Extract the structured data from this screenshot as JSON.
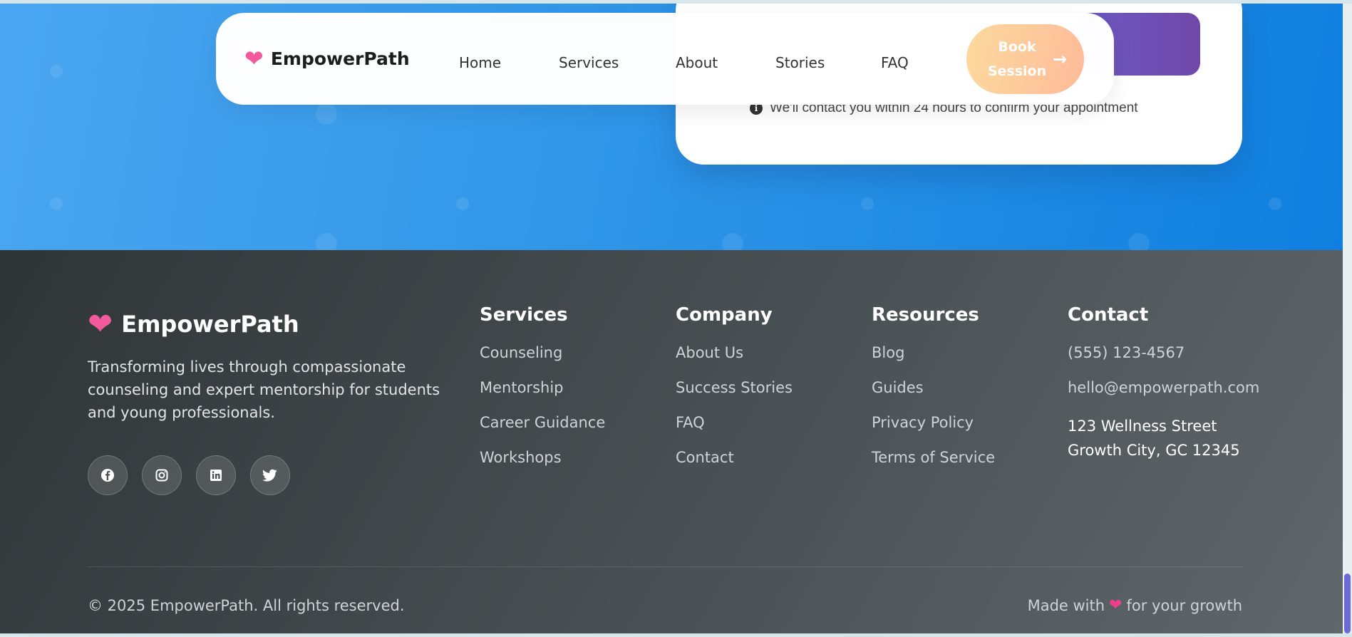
{
  "nav": {
    "brand": "EmpowerPath",
    "links": [
      "Home",
      "Services",
      "About",
      "Stories",
      "FAQ"
    ],
    "cta_label": "Book Session",
    "cta_icon": "arrow-right-icon"
  },
  "booking": {
    "note": "We'll contact you within 24 hours to confirm your appointment",
    "note_icon": "info-icon"
  },
  "footer": {
    "brand": "EmpowerPath",
    "tagline": "Transforming lives through compassionate counseling and expert mentorship for students and young professionals.",
    "socials": [
      "facebook-icon",
      "instagram-icon",
      "linkedin-icon",
      "twitter-icon"
    ],
    "columns": {
      "services": {
        "title": "Services",
        "items": [
          "Counseling",
          "Mentorship",
          "Career Guidance",
          "Workshops"
        ]
      },
      "company": {
        "title": "Company",
        "items": [
          "About Us",
          "Success Stories",
          "FAQ",
          "Contact"
        ]
      },
      "resources": {
        "title": "Resources",
        "items": [
          "Blog",
          "Guides",
          "Privacy Policy",
          "Terms of Service"
        ]
      },
      "contact": {
        "title": "Contact",
        "phone": "(555) 123-4567",
        "email": "hello@empowerpath.com",
        "address_line1": "123 Wellness Street",
        "address_line2": "Growth City, GC 12345"
      }
    },
    "copyright": "© 2025 EmpowerPath. All rights reserved.",
    "made_with_prefix": "Made with",
    "made_with_suffix": "for your growth"
  },
  "colors": {
    "hero_blue": "#2f96e8",
    "brand_pink": "#f25a9c",
    "cta_peach": "#fdc79b",
    "submit_purple": "#6b59c4",
    "footer_dark": "#3a4043"
  }
}
